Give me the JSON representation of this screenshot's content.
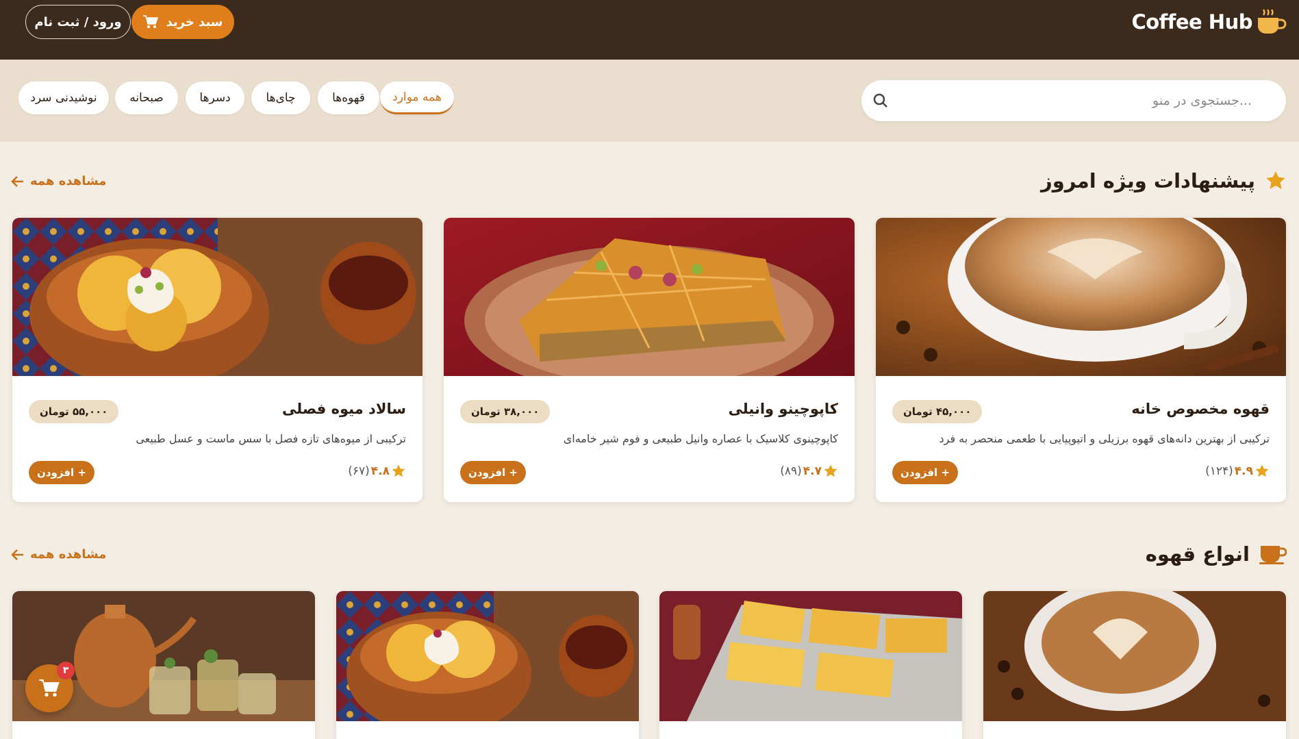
{
  "header": {
    "logo_text": "Coffee Hub",
    "cart_label": "سبد خرید",
    "login_label": "ورود / ثبت نام"
  },
  "search": {
    "placeholder": "جستجوی در منو..."
  },
  "categories": [
    {
      "label": "همه موارد",
      "active": true
    },
    {
      "label": "قهوه‌ها",
      "active": false
    },
    {
      "label": "چای‌ها",
      "active": false
    },
    {
      "label": "دسرها",
      "active": false
    },
    {
      "label": "صبحانه",
      "active": false
    },
    {
      "label": "نوشیدنی سرد",
      "active": false
    }
  ],
  "featured": {
    "title": "پیشنهادات ویژه امروز",
    "see_all": "مشاهده همه",
    "items": [
      {
        "name": "قهوه مخصوص خانه",
        "price": "۴۵,۰۰۰ تومان",
        "desc": "ترکیبی از بهترین دانه‌های قهوه برزیلی و اتیوپیایی با طعمی منحصر به فرد",
        "score": "۴.۹",
        "count": "(۱۲۴)",
        "add": "+ افزودن",
        "image": "latte"
      },
      {
        "name": "کاپوچینو وانیلی",
        "price": "۳۸,۰۰۰ تومان",
        "desc": "کاپوچینوی کلاسیک با عصاره وانیل طبیعی و فوم شیر خامه‌ای",
        "score": "۴.۷",
        "count": "(۸۹)",
        "add": "+ افزودن",
        "image": "baklava"
      },
      {
        "name": "سالاد میوه فصلی",
        "price": "۵۵,۰۰۰ تومان",
        "desc": "ترکیبی از میوه‌های تازه فصل با سس ماست و عسل طبیعی",
        "score": "۴.۸",
        "count": "(۶۷)",
        "add": "+ افزودن",
        "image": "icecream"
      }
    ]
  },
  "coffee": {
    "title": "انواع قهوه",
    "see_all": "مشاهده همه",
    "items": [
      {
        "image": "latte"
      },
      {
        "image": "sohan"
      },
      {
        "image": "icecream"
      },
      {
        "image": "tea"
      }
    ]
  },
  "fab": {
    "badge": "۳"
  },
  "colors": {
    "header_bg": "#3c2a1c",
    "accent": "#e07e1b",
    "accent_dark": "#c8701a",
    "page_bg": "#f3ede3",
    "filter_bg": "#eadfcf"
  }
}
